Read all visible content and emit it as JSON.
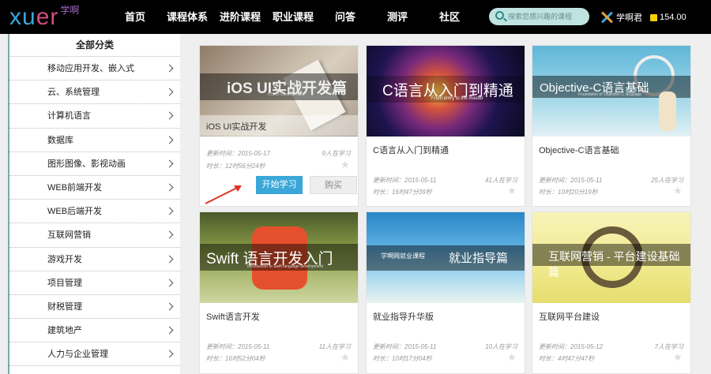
{
  "header": {
    "logo_main": "xuer",
    "logo_sub": "学啊",
    "nav": [
      "首页",
      "课程体系",
      "进阶课程",
      "职业课程",
      "问答",
      "测评",
      "社区"
    ],
    "search_placeholder": "搜索您感兴趣的课程",
    "username": "学啊君",
    "coins": "154.00"
  },
  "sidebar": {
    "title": "全部分类",
    "items": [
      {
        "label": "移动应用开发、嵌入式"
      },
      {
        "label": "云、系统管理"
      },
      {
        "label": "计算机语言"
      },
      {
        "label": "数据库"
      },
      {
        "label": "图形图像、影视动画"
      },
      {
        "label": "WEB前端开发"
      },
      {
        "label": "WEB后端开发"
      },
      {
        "label": "互联网营销"
      },
      {
        "label": "游戏开发"
      },
      {
        "label": "项目管理"
      },
      {
        "label": "财税管理"
      },
      {
        "label": "建筑地产"
      },
      {
        "label": "人力与企业管理"
      }
    ]
  },
  "courses": [
    {
      "thumb_title": "iOS UI实战开发篇",
      "thumb_sub": "iOS UI Development",
      "thumb_caption": "iOS UI实战开发",
      "name": "",
      "date_label": "更新时间：2015-05-17",
      "duration_label": "时长：12时56分24秒",
      "learners": "9人在学习",
      "start_label": "开始学习",
      "buy_label": "购买"
    },
    {
      "thumb_title": "C语言从入门到精通",
      "thumb_sub": "From entry to the master",
      "thumb_caption": "",
      "name": "C语言从入门到精通",
      "date_label": "更新时间：2015-05-11",
      "duration_label": "时长：16时47分39秒",
      "learners": "41人在学习"
    },
    {
      "thumb_title": "Objective-C语言基础",
      "thumb_sub": "Foundation of Objective-C language",
      "thumb_caption": "",
      "name": "Objective-C语言基础",
      "date_label": "更新时间：2015-05-11",
      "duration_label": "时长：10时20分19秒",
      "learners": "25人在学习"
    },
    {
      "thumb_title": "Swift 语言开发入门",
      "thumb_sub": "Introduction to Swift language development",
      "thumb_caption": "",
      "name": "Swift语言开发",
      "date_label": "更新时间：2015-05-11",
      "duration_label": "时长：16时52分04秒",
      "learners": "11人在学习"
    },
    {
      "thumb_title": "就业指导篇",
      "thumb_sub": "学啊网就业课程",
      "thumb_caption": "",
      "name": "就业指导升华版",
      "date_label": "更新时间：2015-05-11",
      "duration_label": "时长：10时17分04秒",
      "learners": "10人在学习"
    },
    {
      "thumb_title": "互联网营销 - 平台建设基础篇",
      "thumb_sub": "",
      "thumb_caption": "",
      "name": "互联网平台建设",
      "date_label": "更新时间：2015-05-12",
      "duration_label": "时长：4时47分47秒",
      "learners": "7人在学习"
    }
  ],
  "colors": {
    "accent": "#3aa7d8",
    "search_bg": "#bfe3e0",
    "coin": "#f5d000",
    "arrow": "#e0342a"
  }
}
